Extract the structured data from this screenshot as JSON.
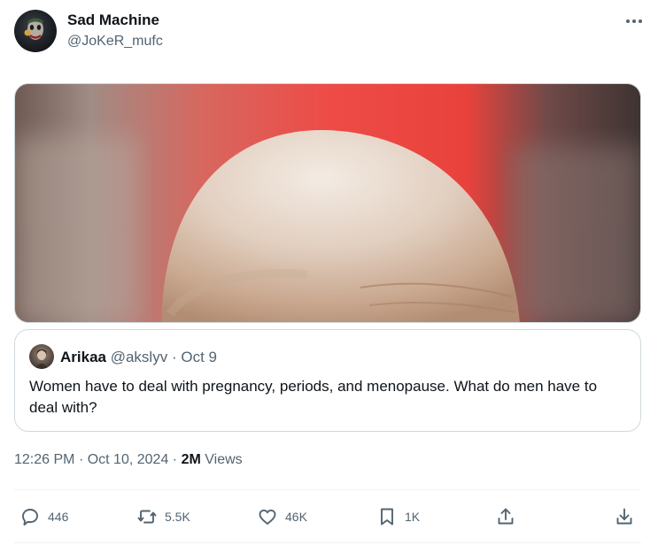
{
  "author": {
    "display_name": "Sad Machine",
    "handle": "@JoKeR_mufc"
  },
  "quote": {
    "name": "Arikaa",
    "handle": "@akslyv",
    "separator": "·",
    "date": "Oct 9",
    "text": "Women have to deal with pregnancy, periods, and menopause. What do men have to deal with?"
  },
  "meta": {
    "time": "12:26 PM",
    "separator": "·",
    "date": "Oct 10, 2024",
    "views_count": "2M",
    "views_label": "Views"
  },
  "actions": {
    "replies": "446",
    "reposts": "5.5K",
    "likes": "46K",
    "bookmarks": "1K"
  },
  "icons": [
    "more-icon",
    "reply-icon",
    "repost-icon",
    "like-icon",
    "bookmark-icon",
    "share-icon",
    "download-icon"
  ]
}
